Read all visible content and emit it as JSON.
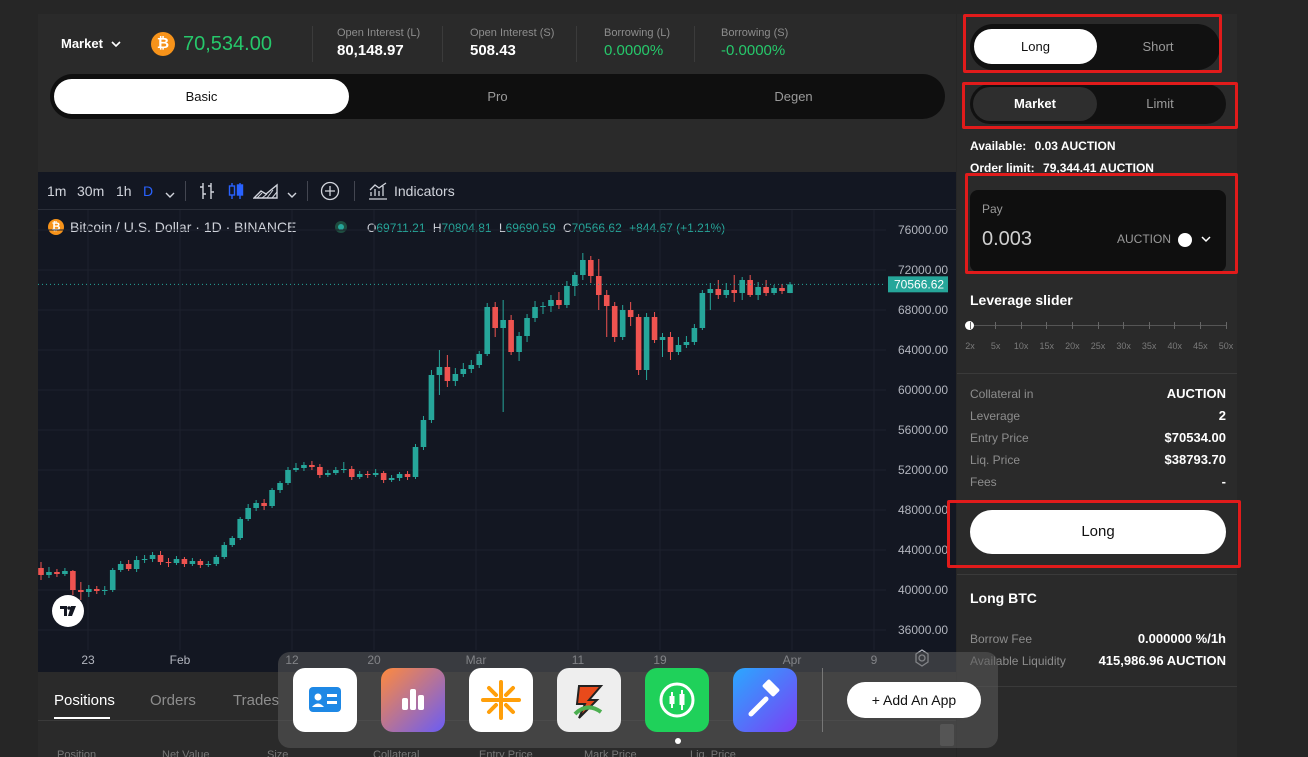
{
  "header": {
    "market_select": "Market",
    "price": "70,534.00",
    "stats": [
      {
        "label": "Open Interest (L)",
        "value": "80,148.97",
        "green": false
      },
      {
        "label": "Open Interest (S)",
        "value": "508.43",
        "green": false
      },
      {
        "label": "Borrowing (L)",
        "value": "0.0000%",
        "green": true
      },
      {
        "label": "Borrowing (S)",
        "value": "-0.0000%",
        "green": true
      }
    ]
  },
  "mode_tabs": [
    "Basic",
    "Pro",
    "Degen"
  ],
  "chart_toolbar": {
    "intervals": [
      "1m",
      "30m",
      "1h",
      "D"
    ],
    "indicators_label": "Indicators"
  },
  "chart_legend": {
    "symbol": "Bitcoin / U.S. Dollar · 1D · BINANCE",
    "o_label": "O",
    "o": "69711.21",
    "h_label": "H",
    "h": "70804.81",
    "l_label": "L",
    "l": "69690.59",
    "c_label": "C",
    "c": "70566.62",
    "change": "+844.67 (+1.21%)"
  },
  "chart_data": {
    "type": "candlestick",
    "y_ticks": [
      "76000.00",
      "72000.00",
      "68000.00",
      "64000.00",
      "60000.00",
      "56000.00",
      "52000.00",
      "48000.00",
      "44000.00",
      "40000.00",
      "36000.00"
    ],
    "x_ticks": [
      "23",
      "Feb",
      "12",
      "20",
      "Mar",
      "11",
      "19",
      "Apr",
      "9"
    ],
    "last_price": "70566.62",
    "ylim": [
      34000,
      78000
    ],
    "candles": [
      [
        42200,
        41500,
        42800,
        41000
      ],
      [
        41500,
        41800,
        42300,
        41200
      ],
      [
        41800,
        41600,
        42100,
        41300
      ],
      [
        41600,
        41900,
        42200,
        41400
      ],
      [
        41900,
        40000,
        42000,
        39500
      ],
      [
        40000,
        39800,
        40800,
        39000
      ],
      [
        39800,
        40100,
        40500,
        39300
      ],
      [
        40100,
        39900,
        40400,
        39600
      ],
      [
        39900,
        40000,
        40400,
        39500
      ],
      [
        40000,
        42000,
        42200,
        39800
      ],
      [
        42000,
        42600,
        42900,
        41800
      ],
      [
        42600,
        42100,
        43000,
        41900
      ],
      [
        42100,
        43000,
        43400,
        41800
      ],
      [
        43000,
        43100,
        43500,
        42700
      ],
      [
        43100,
        43500,
        43800,
        42800
      ],
      [
        43500,
        42800,
        43900,
        42500
      ],
      [
        42800,
        42700,
        43200,
        42300
      ],
      [
        42700,
        43100,
        43400,
        42500
      ],
      [
        43100,
        42600,
        43300,
        42300
      ],
      [
        42600,
        42900,
        43200,
        42400
      ],
      [
        42900,
        42500,
        43100,
        42200
      ],
      [
        42500,
        42600,
        42900,
        42300
      ],
      [
        42600,
        43300,
        43500,
        42400
      ],
      [
        43300,
        44500,
        44800,
        43100
      ],
      [
        44500,
        45200,
        45400,
        44300
      ],
      [
        45200,
        47100,
        47300,
        45000
      ],
      [
        47100,
        48200,
        48600,
        46900
      ],
      [
        48200,
        48700,
        49000,
        47900
      ],
      [
        48700,
        48400,
        49100,
        48000
      ],
      [
        48400,
        50000,
        50200,
        48200
      ],
      [
        50000,
        50700,
        50900,
        49700
      ],
      [
        50700,
        52000,
        52300,
        50500
      ],
      [
        52000,
        52200,
        52700,
        51800
      ],
      [
        52200,
        52500,
        52800,
        51900
      ],
      [
        52500,
        52300,
        52900,
        52000
      ],
      [
        52300,
        51500,
        52600,
        51200
      ],
      [
        51500,
        51700,
        52000,
        51300
      ],
      [
        51700,
        52000,
        52300,
        51500
      ],
      [
        52000,
        52100,
        52800,
        51700
      ],
      [
        52100,
        51300,
        52400,
        51000
      ],
      [
        51300,
        51600,
        51900,
        51100
      ],
      [
        51600,
        51500,
        51900,
        51200
      ],
      [
        51500,
        51700,
        52100,
        51300
      ],
      [
        51700,
        51000,
        51900,
        50700
      ],
      [
        51000,
        51200,
        51500,
        50800
      ],
      [
        51200,
        51600,
        51800,
        50900
      ],
      [
        51600,
        51300,
        51900,
        51000
      ],
      [
        51300,
        54300,
        54600,
        51100
      ],
      [
        54300,
        57000,
        57400,
        54000
      ],
      [
        57000,
        61500,
        62000,
        56700
      ],
      [
        61500,
        62300,
        64000,
        59500
      ],
      [
        62300,
        60900,
        63500,
        60300
      ],
      [
        60900,
        61600,
        62200,
        60400
      ],
      [
        61600,
        62100,
        62700,
        61300
      ],
      [
        62100,
        62500,
        63000,
        61700
      ],
      [
        62500,
        63600,
        63900,
        62200
      ],
      [
        63600,
        68300,
        68700,
        63400
      ],
      [
        68300,
        66200,
        68800,
        65300
      ],
      [
        66200,
        67000,
        69000,
        57800
      ],
      [
        67000,
        63800,
        67500,
        63500
      ],
      [
        63800,
        65400,
        65800,
        62900
      ],
      [
        65400,
        67200,
        67600,
        64800
      ],
      [
        67200,
        68300,
        68900,
        66800
      ],
      [
        68300,
        68400,
        68800,
        67600
      ],
      [
        68400,
        69000,
        69500,
        67800
      ],
      [
        69000,
        68500,
        69800,
        68100
      ],
      [
        68500,
        70400,
        70900,
        68200
      ],
      [
        70400,
        71500,
        71800,
        69400
      ],
      [
        71500,
        73000,
        73700,
        71000
      ],
      [
        73000,
        71400,
        73400,
        70700
      ],
      [
        71400,
        69500,
        73100,
        68000
      ],
      [
        69500,
        68400,
        70000,
        65300
      ],
      [
        68400,
        65300,
        68800,
        64800
      ],
      [
        65300,
        68000,
        68500,
        65000
      ],
      [
        68000,
        67300,
        68800,
        66400
      ],
      [
        67300,
        62000,
        67600,
        61500
      ],
      [
        62000,
        67300,
        67700,
        61000
      ],
      [
        67300,
        65000,
        67800,
        64700
      ],
      [
        65000,
        65300,
        65700,
        63300
      ],
      [
        65300,
        63800,
        65800,
        63000
      ],
      [
        63800,
        64500,
        65300,
        63500
      ],
      [
        64500,
        64800,
        65400,
        64200
      ],
      [
        64800,
        66200,
        66600,
        64500
      ],
      [
        66200,
        69700,
        70000,
        66000
      ],
      [
        69700,
        70100,
        70700,
        68000
      ],
      [
        70100,
        69500,
        71000,
        69100
      ],
      [
        69500,
        70000,
        70700,
        69200
      ],
      [
        70000,
        69700,
        71500,
        68800
      ],
      [
        69700,
        71000,
        71300,
        69000
      ],
      [
        71000,
        69500,
        71500,
        69300
      ],
      [
        69500,
        70300,
        70800,
        69000
      ],
      [
        70300,
        69700,
        71000,
        69400
      ],
      [
        69700,
        70200,
        70500,
        69500
      ],
      [
        70200,
        69900,
        70600,
        69600
      ],
      [
        69700,
        70566,
        70804,
        69690
      ]
    ]
  },
  "right_panel": {
    "side_tabs": [
      "Long",
      "Short"
    ],
    "order_tabs": [
      "Market",
      "Limit"
    ],
    "available_label": "Available:",
    "available_value": "0.03 AUCTION",
    "order_limit_label": "Order limit:",
    "order_limit_value": "79,344.41 AUCTION",
    "pay_label": "Pay",
    "pay_value": "0.003",
    "pay_token": "AUCTION",
    "leverage_title": "Leverage slider",
    "leverage_ticks": [
      "2x",
      "5x",
      "10x",
      "15x",
      "20x",
      "25x",
      "30x",
      "35x",
      "40x",
      "45x",
      "50x"
    ],
    "leverage_value": 2,
    "details": [
      {
        "label": "Collateral in",
        "value": "AUCTION"
      },
      {
        "label": "Leverage",
        "value": "2"
      },
      {
        "label": "Entry Price",
        "value": "$70534.00"
      },
      {
        "label": "Liq. Price",
        "value": "$38793.70"
      },
      {
        "label": "Fees",
        "value": "-"
      }
    ],
    "submit_label": "Long",
    "long_title": "Long BTC",
    "long_rows": [
      {
        "label": "Borrow Fee",
        "value": "0.000000 %/1h"
      },
      {
        "label": "Available Liquidity",
        "value": "415,986.96 AUCTION"
      }
    ]
  },
  "bottom_tabs": [
    "Positions",
    "Orders",
    "Trades"
  ],
  "table_headers": [
    "Position",
    "Net Value",
    "Size",
    "Collateral",
    "Entry Price",
    "Mark Price",
    "Liq. Price"
  ],
  "dock": {
    "add_app_label": "+ Add An App"
  },
  "colors": {
    "up": "#26a69a",
    "down": "#ef5350",
    "accent_green": "#26c86b",
    "highlight_red": "#e11b1b",
    "bitcoin_orange": "#f7931a"
  }
}
